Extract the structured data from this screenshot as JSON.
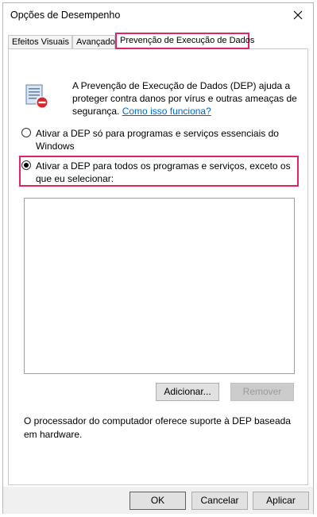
{
  "window": {
    "title": "Opções de Desempenho"
  },
  "tabs": [
    {
      "label": "Efeitos Visuais"
    },
    {
      "label": "Avançado"
    },
    {
      "label": "Prevenção de Execução de Dados"
    }
  ],
  "description": {
    "text": "A Prevenção de Execução de Dados (DEP) ajuda a proteger contra danos por vírus e outras ameaças de segurança.",
    "link": "Como isso funciona?"
  },
  "options": [
    {
      "label": "Ativar a DEP só para programas e serviços essenciais do Windows",
      "selected": false
    },
    {
      "label": "Ativar a DEP para todos os programas e serviços, exceto os que eu selecionar:",
      "selected": true
    }
  ],
  "list_buttons": {
    "add": "Adicionar...",
    "remove": "Remover"
  },
  "footer_text": "O processador do computador oferece suporte à DEP baseada em hardware.",
  "dialog_buttons": {
    "ok": "OK",
    "cancel": "Cancelar",
    "apply": "Aplicar"
  },
  "colors": {
    "highlight": "#e0236b",
    "link": "#0066cc"
  },
  "icons": {
    "close": "close-icon",
    "dep": "dep-shield-icon"
  }
}
